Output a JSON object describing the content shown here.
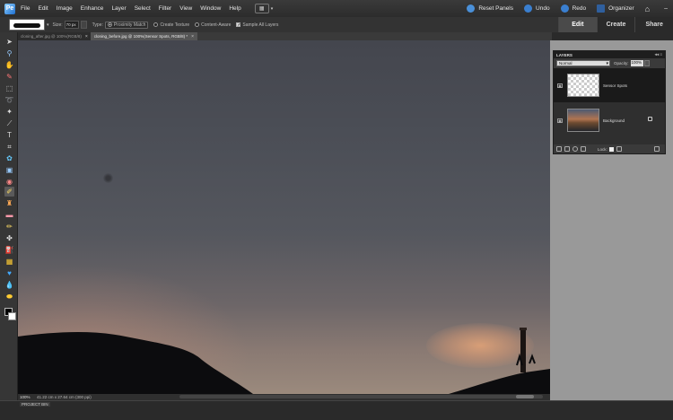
{
  "menubar": {
    "logo": "Pe",
    "items": [
      "File",
      "Edit",
      "Image",
      "Enhance",
      "Layer",
      "Select",
      "Filter",
      "View",
      "Window",
      "Help"
    ],
    "right": {
      "reset": "Reset Panels",
      "undo": "Undo",
      "redo": "Redo",
      "organizer": "Organizer"
    }
  },
  "options": {
    "size_label": "Size:",
    "size_value": "70 px",
    "type_label": "Type:",
    "proximity": "Proximity Match",
    "texture": "Create Texture",
    "content": "Content-Aware",
    "sample": "Sample All Layers"
  },
  "modes": {
    "edit": "Edit",
    "create": "Create",
    "share": "Share"
  },
  "doc_tabs": [
    {
      "label": "cloning_after.jpg @ 100%(RGB/8)"
    },
    {
      "label": "cloning_before.jpg @ 100%(Sensor Spots, RGB/8) *"
    }
  ],
  "status": {
    "zoom": "100%",
    "info": "41.22 cm x 27.64 cm (300 ppi)"
  },
  "project_bin": "PROJECT BIN",
  "layers": {
    "title": "LAYERS",
    "blend_mode": "Normal",
    "opacity_label": "Opacity:",
    "opacity": "100%",
    "lock_label": "Lock:",
    "items": [
      {
        "name": "Sensor Spots"
      },
      {
        "name": "Background"
      }
    ]
  },
  "colors": {
    "accent": "#4a90d9",
    "bg": "#2a2a2a",
    "panel": "#999999"
  }
}
